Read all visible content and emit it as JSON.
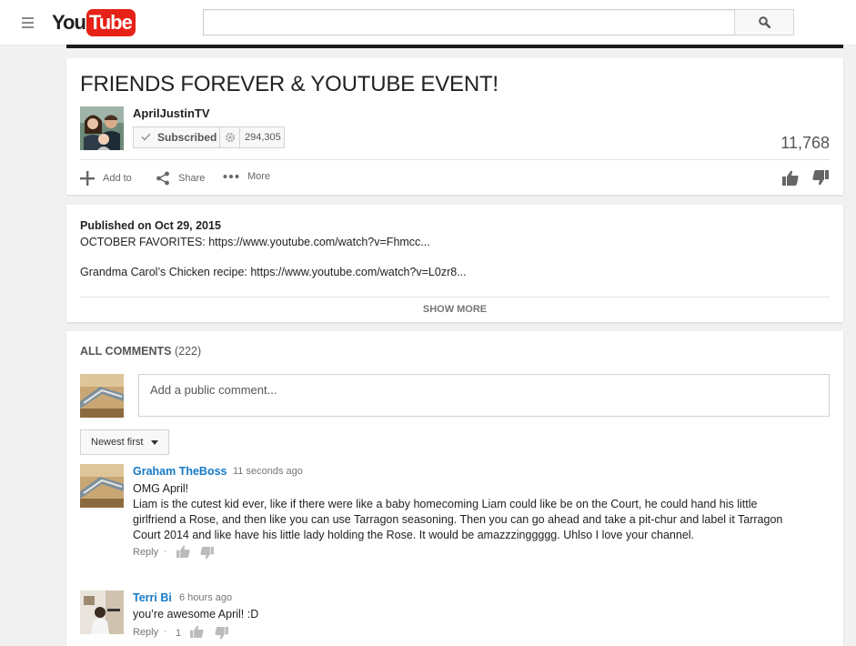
{
  "colors": {
    "brand_red": "#e62117",
    "link_blue": "#167ac6",
    "page_bg": "#f1f1f1"
  },
  "masthead": {
    "menu_icon": "hamburger-icon",
    "logo_you": "You",
    "logo_tube": "Tube",
    "search": {
      "value": "",
      "placeholder": ""
    },
    "search_icon": "search-icon"
  },
  "video": {
    "title": "FRIENDS FOREVER & YOUTUBE EVENT!",
    "channel": "AprilJustinTV",
    "subscribe_label": "Subscribed",
    "subscriber_count": "294,305",
    "view_count": "11,768",
    "actions": {
      "add_to": "Add to",
      "share": "Share",
      "more": "More"
    }
  },
  "description": {
    "published": "Published on Oct 29, 2015",
    "lines": [
      "OCTOBER FAVORITES: https://www.youtube.com/watch?v=Fhmcc...",
      "Grandma Carol’s Chicken recipe: https://www.youtube.com/watch?v=L0zr8..."
    ],
    "show_more": "SHOW MORE"
  },
  "comments": {
    "header_label": "ALL COMMENTS",
    "header_count": "(222)",
    "input_placeholder": "Add a public comment...",
    "sort_label": "Newest first",
    "items": [
      {
        "author": "Graham TheBoss",
        "time": "11 seconds ago",
        "lines": [
          "OMG April!",
          "Liam is the cutest kid ever, like if there were like a baby homecoming Liam could like be on the Court, he could hand his little",
          "girlfriend a Rose, and then like you can use Tarragon seasoning. Then you can go ahead and take a pit-chur and label it Tarragon",
          "Court 2014 and like have his little lady holding the Rose. It would be amazzzinggggg. Uhlso I love your channel."
        ],
        "reply": "Reply",
        "likes": ""
      },
      {
        "author": "Terri Bi",
        "time": "6 hours ago",
        "lines": [
          "you’re awesome April! :D"
        ],
        "reply": "Reply",
        "likes": "1"
      }
    ]
  }
}
